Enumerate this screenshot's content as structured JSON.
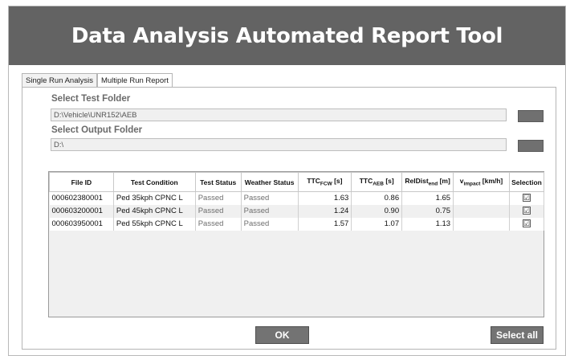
{
  "app": {
    "title": "Data Analysis Automated Report Tool"
  },
  "tabs": [
    {
      "label": "Single Run Analysis"
    },
    {
      "label": "Multiple Run Report"
    }
  ],
  "test_folder": {
    "label": "Select Test Folder",
    "value": "D:\\Vehicle\\UNR152\\AEB"
  },
  "output_folder": {
    "label": "Select Output Folder",
    "value": "D:\\"
  },
  "table": {
    "headers": {
      "file_id": "File ID",
      "test_condition": "Test Condition",
      "test_status": "Test Status",
      "weather_status": "Weather Status",
      "ttc_fcw": {
        "main": "TTC",
        "sub": "FCW",
        "unit": " [s]"
      },
      "ttc_aeb": {
        "main": "TTC",
        "sub": "AEB",
        "unit": " [s]"
      },
      "reldist": {
        "main": "RelDist",
        "sub": "end",
        "unit": " [m]"
      },
      "v_impact": {
        "main": "v",
        "sub": "impact",
        "unit": " [km/h]"
      },
      "selection": "Selection"
    },
    "rows": [
      {
        "file_id": "000602380001",
        "test_condition": "Ped 35kph CPNC L",
        "test_status": "Passed",
        "weather_status": "Passed",
        "ttc_fcw": "1.63",
        "ttc_aeb": "0.86",
        "reldist": "1.65",
        "v_impact": "",
        "selected": "☑"
      },
      {
        "file_id": "000603200001",
        "test_condition": "Ped 45kph CPNC L",
        "test_status": "Passed",
        "weather_status": "Passed",
        "ttc_fcw": "1.24",
        "ttc_aeb": "0.90",
        "reldist": "0.75",
        "v_impact": "",
        "selected": "☑"
      },
      {
        "file_id": "000603950001",
        "test_condition": "Ped 55kph CPNC L",
        "test_status": "Passed",
        "weather_status": "Passed",
        "ttc_fcw": "1.57",
        "ttc_aeb": "1.07",
        "reldist": "1.13",
        "v_impact": "",
        "selected": "☑"
      }
    ]
  },
  "buttons": {
    "ok": "OK",
    "select_all": "Select all"
  },
  "colors": {
    "titlebar": "#636363",
    "button": "#737373"
  }
}
